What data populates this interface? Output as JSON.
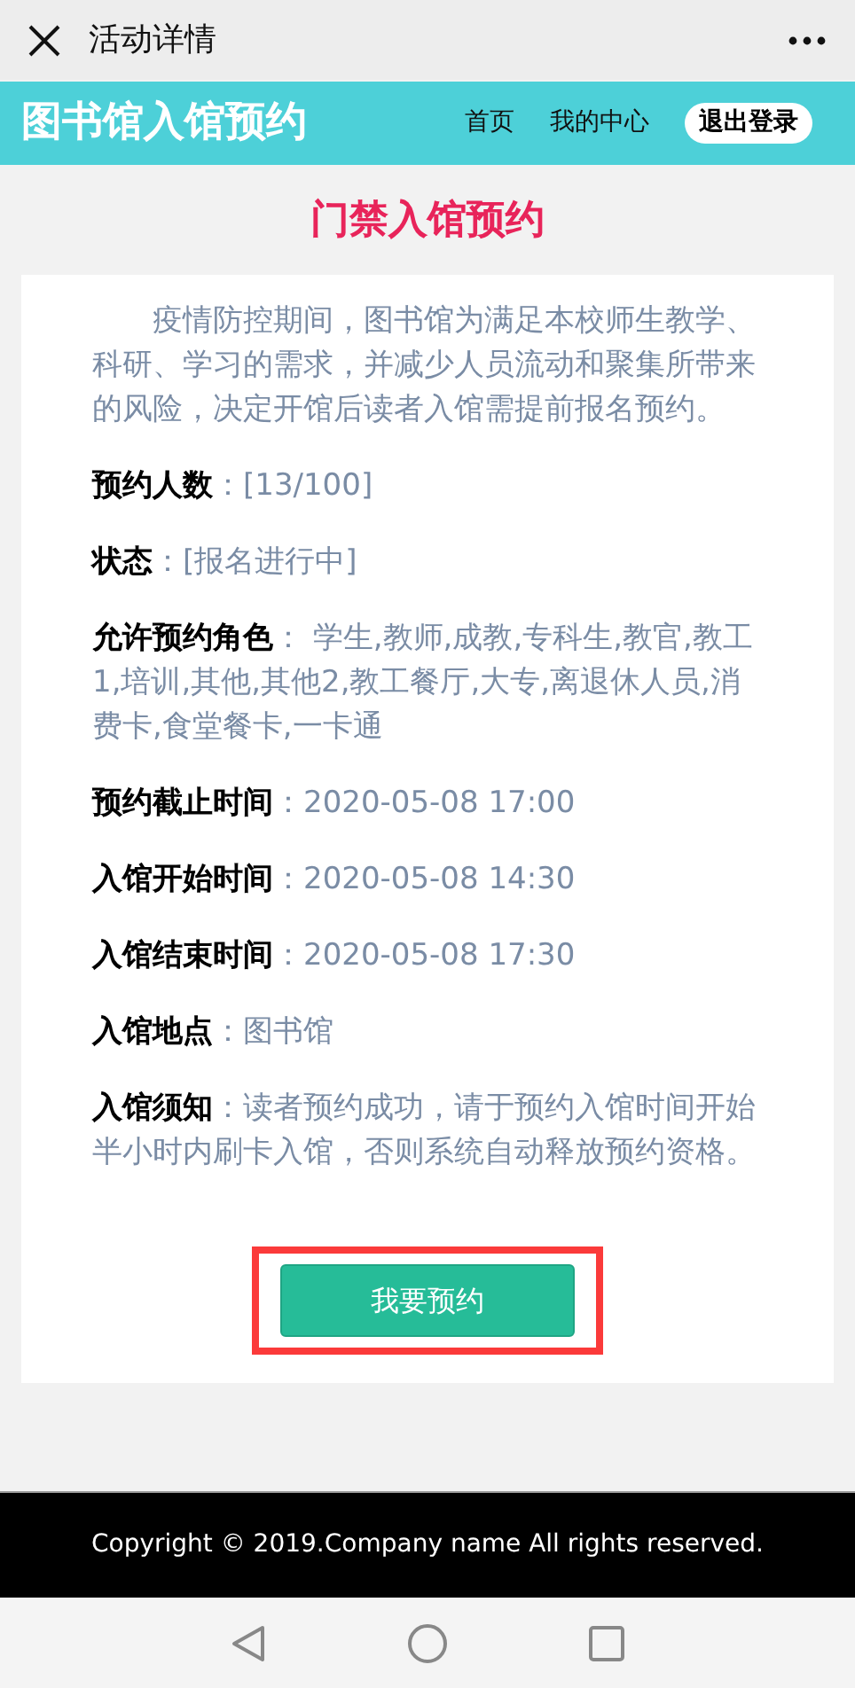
{
  "topbar": {
    "title": "活动详情"
  },
  "header": {
    "brand": "图书馆入馆预约",
    "nav": [
      {
        "label": "首页",
        "kind": "link"
      },
      {
        "label": "我的中心",
        "kind": "link"
      },
      {
        "label": "退出登录",
        "kind": "pill"
      }
    ]
  },
  "page_title": "门禁入馆预约",
  "intro": "疫情防控期间，图书馆为满足本校师生教学、科研、学习的需求，并减少人员流动和聚集所带来的风险，决定开馆后读者入馆需提前报名预约。",
  "details": [
    {
      "label": "预约人数",
      "value": "：[13/100]"
    },
    {
      "label": "状态",
      "value": "：[报名进行中]"
    },
    {
      "label": "允许预约角色",
      "value": "： 学生,教师,成教,专科生,教官,教工1,培训,其他,其他2,教工餐厅,大专,离退休人员,消费卡,食堂餐卡,一卡通"
    },
    {
      "label": "预约截止时间",
      "value": "：2020-05-08 17:00"
    },
    {
      "label": "入馆开始时间",
      "value": "：2020-05-08 14:30"
    },
    {
      "label": "入馆结束时间",
      "value": "：2020-05-08 17:30"
    },
    {
      "label": "入馆地点",
      "value": "：图书馆"
    },
    {
      "label": "入馆须知",
      "value": "：读者预约成功，请于预约入馆时间开始半小时内刷卡入馆，否则系统自动释放预约资格。"
    }
  ],
  "action": {
    "label": "我要预约",
    "highlighted": true
  },
  "footer": "Copyright © 2019.Company name All rights reserved."
}
